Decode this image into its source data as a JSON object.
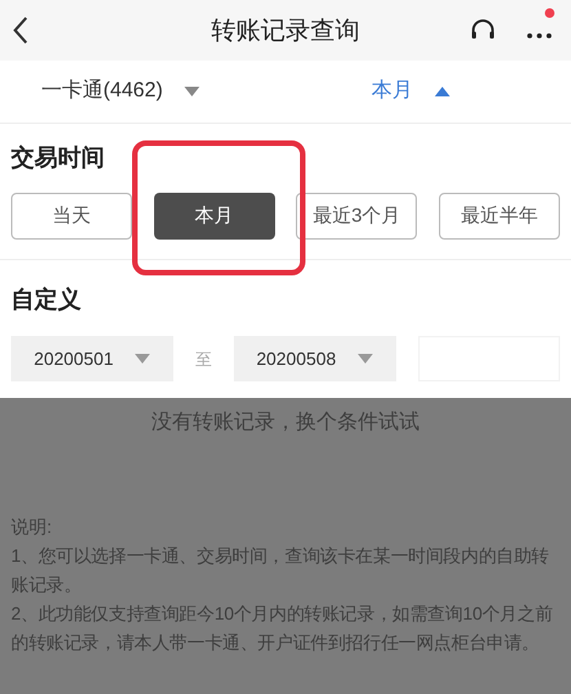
{
  "header": {
    "title": "转账记录查询",
    "notification_dot": true
  },
  "filter_bar": {
    "account": "一卡通(4462)",
    "period": "本月",
    "period_expanded": true
  },
  "trade_time": {
    "heading": "交易时间",
    "options": [
      {
        "label": "当天",
        "selected": false
      },
      {
        "label": "本月",
        "selected": true
      },
      {
        "label": "最近3个月",
        "selected": false
      },
      {
        "label": "最近半年",
        "selected": false
      }
    ]
  },
  "custom": {
    "heading": "自定义",
    "start_date": "20200501",
    "separator": "至",
    "end_date": "20200508",
    "confirm_disabled": true
  },
  "results": {
    "empty_message": "没有转账记录，换个条件试试"
  },
  "notes": {
    "heading": "说明:",
    "items": [
      "1、您可以选择一卡通、交易时间，查询该卡在某一时间段内的自助转账记录。",
      "2、此功能仅支持查询距今10个月内的转账记录，如需查询10个月之前的转账记录，请本人带一卡通、开户证件到招行任一网点柜台申请。"
    ]
  }
}
